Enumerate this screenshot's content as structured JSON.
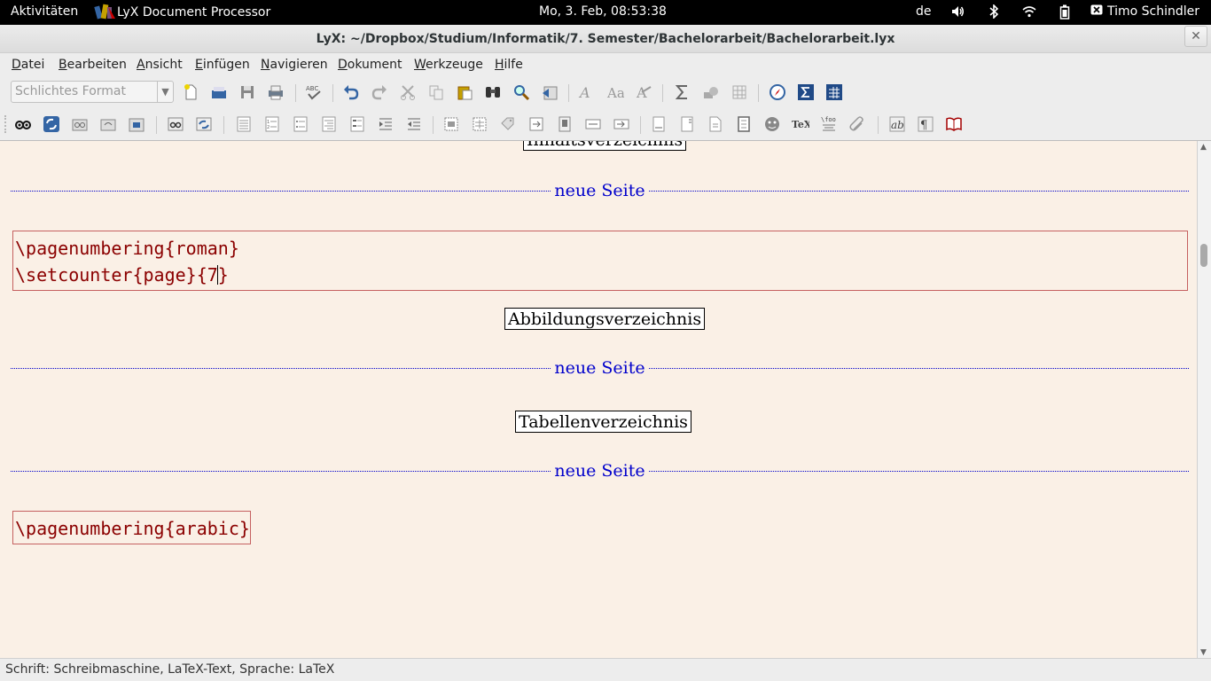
{
  "topbar": {
    "activities": "Aktivitäten",
    "app_name": "LyX Document Processor",
    "clock": "Mo,  3. Feb, 08:53:38",
    "keyboard_layout": "de",
    "tray_icons": [
      "volume-icon",
      "bluetooth-icon",
      "wifi-icon",
      "battery-icon"
    ],
    "user": "Timo Schindler"
  },
  "window": {
    "title": "LyX: ~/Dropbox/Studium/Informatik/7. Semester/Bachelorarbeit/Bachelorarbeit.lyx",
    "close_glyph": "✕"
  },
  "menu": {
    "items": [
      {
        "label": "Datei",
        "mnemonic": "D"
      },
      {
        "label": "Bearbeiten",
        "mnemonic": "B"
      },
      {
        "label": "Ansicht",
        "mnemonic": "A"
      },
      {
        "label": "Einfügen",
        "mnemonic": "E"
      },
      {
        "label": "Navigieren",
        "mnemonic": "N"
      },
      {
        "label": "Dokument",
        "mnemonic": "D"
      },
      {
        "label": "Werkzeuge",
        "mnemonic": "W"
      },
      {
        "label": "Hilfe",
        "mnemonic": "H"
      }
    ]
  },
  "toolbar": {
    "layout_combo_value": "Schlichtes Format"
  },
  "document": {
    "toc_label": "Inhaltsverzeichnis",
    "pagebreak_label": "neue Seite",
    "ert1_line1": "\\pagenumbering{roman}",
    "ert1_line2_before_caret": "\\setcounter{page}{7",
    "ert1_line2_after_caret": "}",
    "lof_label": "Abbildungsverzeichnis",
    "lot_label": "Tabellenverzeichnis",
    "ert2": "\\pagenumbering{arabic}"
  },
  "statusbar": {
    "text": "Schrift: Schreibmaschine, LaTeX-Text, Sprache: LaTeX"
  },
  "colors": {
    "document_bg": "#faf0e6",
    "pagebreak": "#0000cc",
    "ert_text": "#8b0000",
    "ert_border": "#c56060"
  }
}
